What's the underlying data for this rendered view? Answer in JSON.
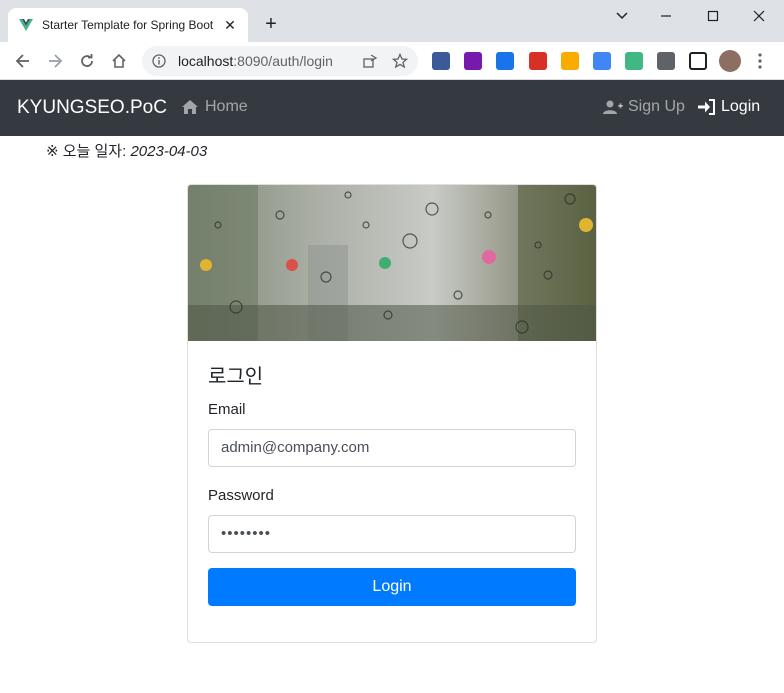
{
  "browser": {
    "tab_title": "Starter Template for Spring Boot",
    "url_host": "localhost",
    "url_path": ":8090/auth/login"
  },
  "navbar": {
    "brand": "KYUNGSEO.PoC",
    "home": "Home",
    "signup": "Sign Up",
    "login": "Login"
  },
  "today": {
    "prefix": "※ 오늘 일자: ",
    "date": "2023-04-03"
  },
  "login_card": {
    "title": "로그인",
    "email_label": "Email",
    "email_value": "admin@company.com",
    "password_label": "Password",
    "password_value": "••••••••",
    "submit": "Login"
  },
  "colors": {
    "navbar_bg": "#343a40",
    "primary": "#007bff"
  }
}
